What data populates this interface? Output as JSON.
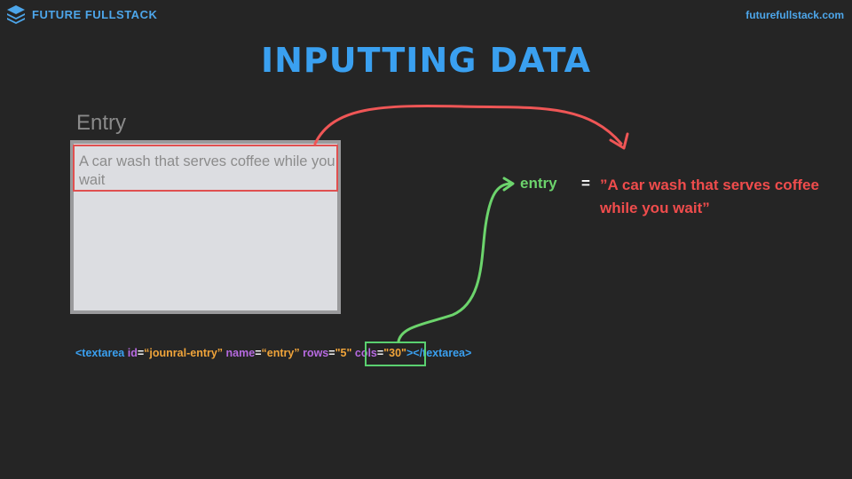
{
  "header": {
    "brand": "FUTURE FULLSTACK",
    "site": "futurefullstack.com"
  },
  "title": "INPUTTING DATA",
  "form": {
    "label": "Entry",
    "textarea_value": "A car wash that serves coffee while you wait"
  },
  "code": {
    "open_tag": "<textarea",
    "attr_id": "id",
    "val_id": "“jounral-entry”",
    "attr_name": "name",
    "val_name": "“entry”",
    "attr_rows": "rows",
    "val_rows": "\"5\"",
    "attr_cols": "cols",
    "val_cols": "\"30\"",
    "close_tag": "></textarea>"
  },
  "result": {
    "variable": "entry",
    "equals": "=",
    "value": "”A car wash that serves coffee while you wait”"
  },
  "colors": {
    "background": "#252525",
    "brand_blue": "#3aa0f0",
    "red": "#ef4c4c",
    "green": "#6cd46c",
    "orange": "#f0a43a",
    "purple": "#b66ae0"
  }
}
